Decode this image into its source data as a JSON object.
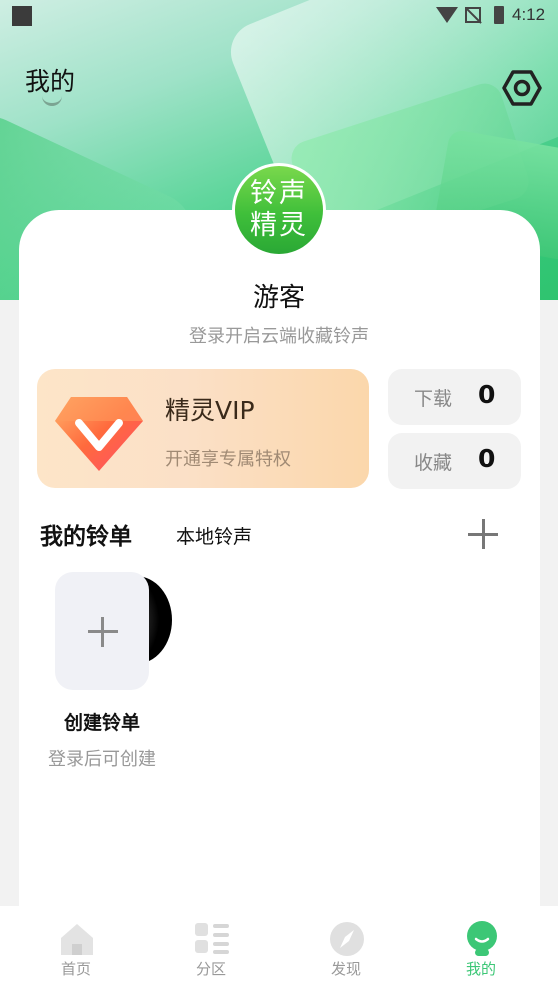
{
  "status_bar": {
    "time": "4:12"
  },
  "header": {
    "title": "我的"
  },
  "profile": {
    "avatar_text_line1": "铃声",
    "avatar_text_line2": "精灵",
    "username": "游客",
    "login_hint": "登录开启云端收藏铃声"
  },
  "vip": {
    "title": "精灵VIP",
    "subtitle": "开通享专属特权"
  },
  "stats": [
    {
      "label": "下载",
      "value": "0"
    },
    {
      "label": "收藏",
      "value": "0"
    }
  ],
  "tabs": {
    "active": "我的铃单",
    "other": "本地铃声"
  },
  "playlist": {
    "title": "创建铃单",
    "subtitle": "登录后可创建"
  },
  "bottom_nav": {
    "items": [
      {
        "label": "首页",
        "icon": "home-icon",
        "active": false
      },
      {
        "label": "分区",
        "icon": "category-icon",
        "active": false
      },
      {
        "label": "发现",
        "icon": "compass-icon",
        "active": false
      },
      {
        "label": "我的",
        "icon": "profile-icon",
        "active": true
      }
    ]
  },
  "colors": {
    "accent": "#3cc776",
    "vip_bg": "#fbdcb8"
  }
}
